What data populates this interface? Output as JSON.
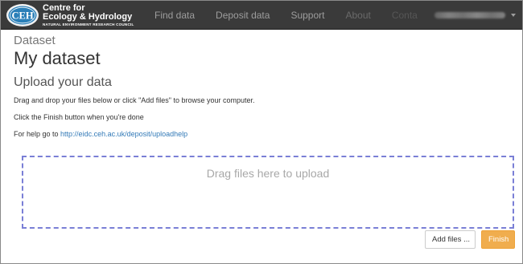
{
  "header": {
    "logo": {
      "badge_text": "CEH",
      "line1": "Centre for",
      "line2": "Ecology & Hydrology",
      "line3": "NATURAL ENVIRONMENT RESEARCH COUNCIL"
    },
    "nav": [
      {
        "label": "Find data"
      },
      {
        "label": "Deposit data"
      },
      {
        "label": "Support"
      },
      {
        "label": "About"
      },
      {
        "label": "Conta"
      }
    ],
    "user_menu": {
      "icon": "caret-down-icon"
    }
  },
  "page": {
    "subtitle": "Dataset",
    "title": "My dataset",
    "section_title": "Upload your data",
    "instruction_1": "Drag and drop your files below or click \"Add files\" to browse your computer.",
    "instruction_2": "Click the Finish button when you're done",
    "help_prefix": "For help go to ",
    "help_link": "http://eidc.ceh.ac.uk/deposit/uploadhelp"
  },
  "upload": {
    "dropzone_text": "Drag files here to upload",
    "add_files_label": "Add files ...",
    "finish_label": "Finish"
  },
  "colors": {
    "navbar": "#3a3a3a",
    "link": "#337ab7",
    "finish": "#f0ad4e",
    "dropzone_border": "#7a7fd6"
  }
}
